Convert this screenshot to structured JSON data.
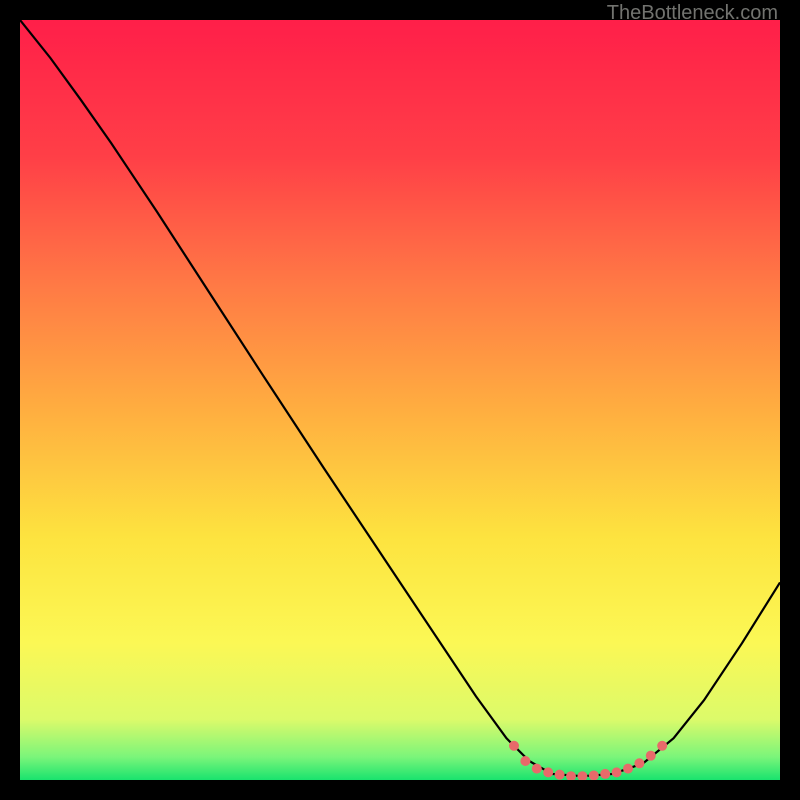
{
  "watermark": "TheBottleneck.com",
  "chart_data": {
    "type": "line",
    "title": "",
    "xlabel": "",
    "ylabel": "",
    "xlim": [
      0,
      100
    ],
    "ylim": [
      0,
      100
    ],
    "gradient_stops": [
      {
        "offset": 0,
        "color": "#ff1f49"
      },
      {
        "offset": 18,
        "color": "#ff3f47"
      },
      {
        "offset": 35,
        "color": "#ff7a45"
      },
      {
        "offset": 52,
        "color": "#ffb040"
      },
      {
        "offset": 68,
        "color": "#fde33f"
      },
      {
        "offset": 82,
        "color": "#fbf855"
      },
      {
        "offset": 92,
        "color": "#dcfa6a"
      },
      {
        "offset": 97,
        "color": "#7af57a"
      },
      {
        "offset": 100,
        "color": "#19e36e"
      }
    ],
    "series": [
      {
        "name": "bottleneck-curve",
        "color": "#000000",
        "points": [
          {
            "x": 0.0,
            "y": 100.0
          },
          {
            "x": 4.0,
            "y": 95.0
          },
          {
            "x": 8.0,
            "y": 89.5
          },
          {
            "x": 12.0,
            "y": 83.8
          },
          {
            "x": 18.0,
            "y": 74.8
          },
          {
            "x": 25.0,
            "y": 64.0
          },
          {
            "x": 32.0,
            "y": 53.2
          },
          {
            "x": 40.0,
            "y": 41.0
          },
          {
            "x": 48.0,
            "y": 29.0
          },
          {
            "x": 55.0,
            "y": 18.5
          },
          {
            "x": 60.0,
            "y": 11.0
          },
          {
            "x": 64.0,
            "y": 5.5
          },
          {
            "x": 67.0,
            "y": 2.5
          },
          {
            "x": 70.0,
            "y": 0.8
          },
          {
            "x": 74.0,
            "y": 0.5
          },
          {
            "x": 78.0,
            "y": 0.8
          },
          {
            "x": 82.0,
            "y": 2.2
          },
          {
            "x": 86.0,
            "y": 5.5
          },
          {
            "x": 90.0,
            "y": 10.5
          },
          {
            "x": 95.0,
            "y": 18.0
          },
          {
            "x": 100.0,
            "y": 26.0
          }
        ]
      },
      {
        "name": "optimal-marker",
        "color": "#e86a6a",
        "type": "scatter",
        "points": [
          {
            "x": 65.0,
            "y": 4.5
          },
          {
            "x": 66.5,
            "y": 2.5
          },
          {
            "x": 68.0,
            "y": 1.5
          },
          {
            "x": 69.5,
            "y": 1.0
          },
          {
            "x": 71.0,
            "y": 0.7
          },
          {
            "x": 72.5,
            "y": 0.5
          },
          {
            "x": 74.0,
            "y": 0.5
          },
          {
            "x": 75.5,
            "y": 0.6
          },
          {
            "x": 77.0,
            "y": 0.8
          },
          {
            "x": 78.5,
            "y": 1.0
          },
          {
            "x": 80.0,
            "y": 1.5
          },
          {
            "x": 81.5,
            "y": 2.2
          },
          {
            "x": 83.0,
            "y": 3.2
          },
          {
            "x": 84.5,
            "y": 4.5
          }
        ]
      }
    ]
  }
}
